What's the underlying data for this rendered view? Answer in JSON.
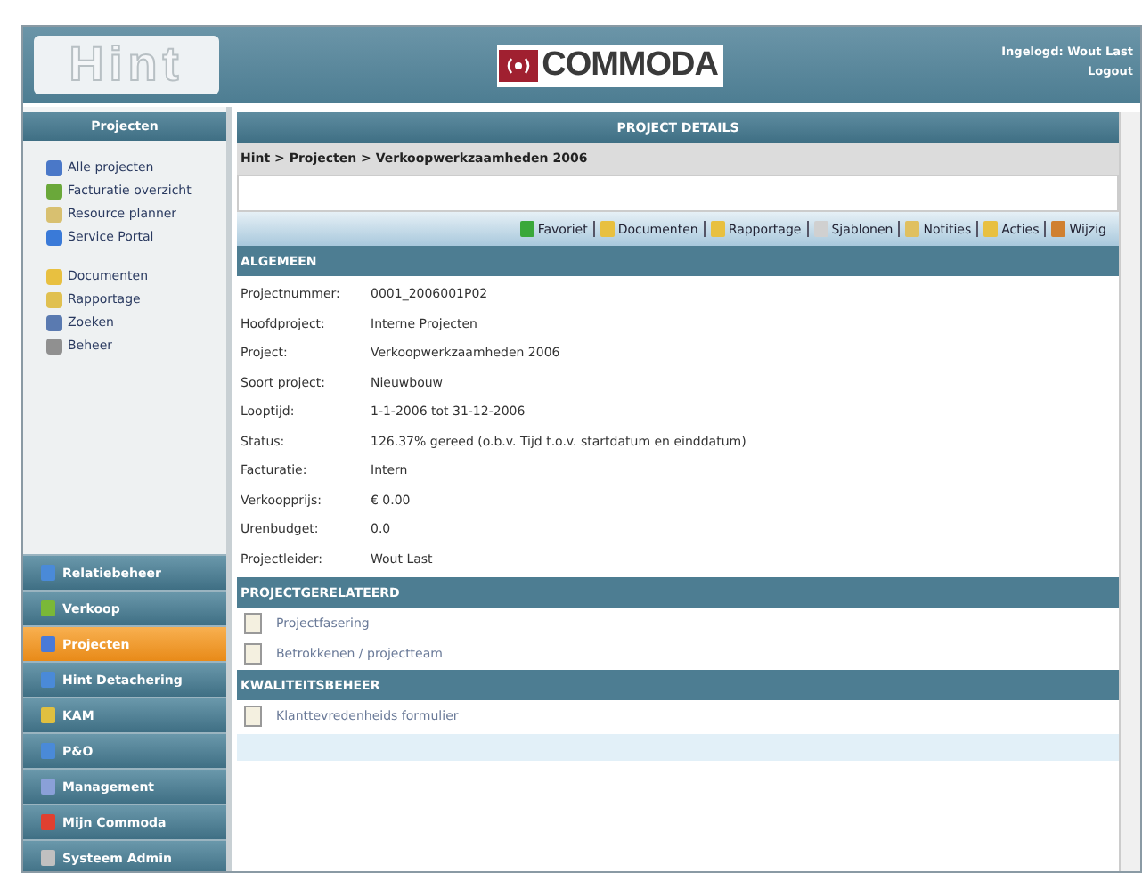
{
  "header": {
    "logo": "Hint",
    "brand": "COMMODA",
    "user": "Ingelogd: Wout Last",
    "logout": "Logout"
  },
  "sidebar": {
    "title": "Projecten",
    "groups": [
      {
        "items": [
          {
            "label": "Alle projecten"
          },
          {
            "label": "Facturatie overzicht"
          },
          {
            "label": "Resource planner"
          },
          {
            "label": "Service Portal"
          }
        ]
      },
      {
        "items": [
          {
            "label": "Documenten"
          },
          {
            "label": "Rapportage"
          },
          {
            "label": "Zoeken"
          },
          {
            "label": "Beheer"
          }
        ]
      }
    ],
    "modules": [
      {
        "label": "Relatiebeheer",
        "selected": false
      },
      {
        "label": "Verkoop",
        "selected": false
      },
      {
        "label": "Projecten",
        "selected": true
      },
      {
        "label": "Hint Detachering",
        "selected": false
      },
      {
        "label": "KAM",
        "selected": false
      },
      {
        "label": "P&O",
        "selected": false
      },
      {
        "label": "Management",
        "selected": false
      },
      {
        "label": "Mijn Commoda",
        "selected": false
      },
      {
        "label": "Systeem Admin",
        "selected": false
      }
    ]
  },
  "main": {
    "title": "PROJECT DETAILS",
    "breadcrumb": "Hint > Projecten > Verkoopwerkzaamheden 2006",
    "toolbar": [
      "Favoriet",
      "Documenten",
      "Rapportage",
      "Sjablonen",
      "Notities",
      "Acties",
      "Wijzig"
    ],
    "sections": [
      {
        "title": "ALGEMEEN",
        "kind": "fields",
        "fields": [
          {
            "label": "Projectnummer:",
            "value": "0001_2006001P02"
          },
          {
            "label": "Hoofdproject:",
            "value": "Interne Projecten"
          },
          {
            "label": "Project:",
            "value": "Verkoopwerkzaamheden 2006"
          },
          {
            "label": "Soort project:",
            "value": "Nieuwbouw"
          },
          {
            "label": "Looptijd:",
            "value": "1-1-2006 tot 31-12-2006"
          },
          {
            "label": "Status:",
            "value": "126.37% gereed (o.b.v. Tijd t.o.v. startdatum en einddatum)"
          },
          {
            "label": "Facturatie:",
            "value": "Intern"
          },
          {
            "label": "Verkoopprijs:",
            "value": "€ 0.00"
          },
          {
            "label": "Urenbudget:",
            "value": "0.0"
          },
          {
            "label": "Projectleider:",
            "value": "Wout Last"
          }
        ]
      },
      {
        "title": "PROJECTGERELATEERD",
        "kind": "links",
        "links": [
          "Projectfasering",
          "Betrokkenen / projectteam"
        ]
      },
      {
        "title": "KWALITEITSBEHEER",
        "kind": "links",
        "links": [
          "Klanttevredenheids formulier"
        ]
      }
    ]
  }
}
